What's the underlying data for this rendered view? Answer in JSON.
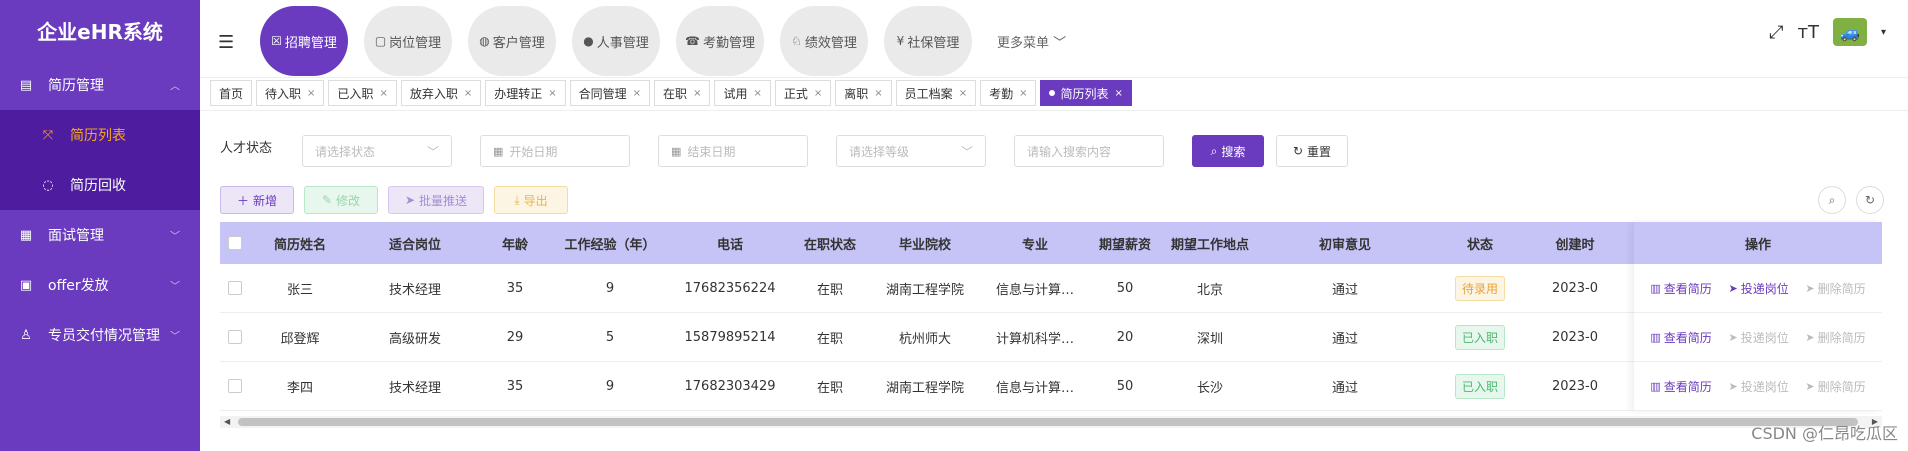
{
  "sidebar": {
    "title": "企业eHR系统",
    "menu": [
      {
        "label": "简历管理",
        "icon": "document-icon",
        "glyph": "▤"
      },
      {
        "label": "面试管理",
        "icon": "interview-icon",
        "glyph": "▦"
      },
      {
        "label": "offer发放",
        "icon": "offer-icon",
        "glyph": "▣"
      },
      {
        "label": "专员交付情况管理",
        "icon": "person-icon",
        "glyph": "♙"
      }
    ],
    "submenu": [
      {
        "label": "简历列表",
        "glyph": "⤧"
      },
      {
        "label": "简历回收",
        "glyph": "◌"
      }
    ]
  },
  "header": {
    "nav": [
      {
        "label": "招聘管理",
        "glyph": "☒"
      },
      {
        "label": "岗位管理",
        "glyph": "▢"
      },
      {
        "label": "客户管理",
        "glyph": "◍"
      },
      {
        "label": "人事管理",
        "glyph": "●"
      },
      {
        "label": "考勤管理",
        "glyph": "☎"
      },
      {
        "label": "绩效管理",
        "glyph": "♘"
      },
      {
        "label": "社保管理",
        "glyph": "¥"
      }
    ],
    "more": "更多菜单"
  },
  "tags": [
    {
      "label": "首页",
      "closable": false
    },
    {
      "label": "待入职",
      "closable": true
    },
    {
      "label": "已入职",
      "closable": true
    },
    {
      "label": "放弃入职",
      "closable": true
    },
    {
      "label": "办理转正",
      "closable": true
    },
    {
      "label": "合同管理",
      "closable": true
    },
    {
      "label": "在职",
      "closable": true
    },
    {
      "label": "试用",
      "closable": true
    },
    {
      "label": "正式",
      "closable": true
    },
    {
      "label": "离职",
      "closable": true
    },
    {
      "label": "员工档案",
      "closable": true
    },
    {
      "label": "考勤",
      "closable": true
    },
    {
      "label": "简历列表",
      "closable": true
    }
  ],
  "filter": {
    "label": "人才状态",
    "status_placeholder": "请选择状态",
    "start_placeholder": "开始日期",
    "end_placeholder": "结束日期",
    "level_placeholder": "请选择等级",
    "search_placeholder": "请输入搜索内容",
    "search_btn": "搜索",
    "reset_btn": "重置"
  },
  "toolbar": {
    "add": "新增",
    "edit": "修改",
    "push": "批量推送",
    "export": "导出"
  },
  "table": {
    "columns": [
      "简历姓名",
      "适合岗位",
      "年龄",
      "工作经验（年）",
      "电话",
      "在职状态",
      "毕业院校",
      "专业",
      "期望薪资",
      "期望工作地点",
      "初审意见",
      "状态",
      "创建时"
    ],
    "rows": [
      [
        "张三",
        "技术经理",
        "35",
        "9",
        "17682356224",
        "在职",
        "湖南工程学院",
        "信息与计算…",
        "50",
        "北京",
        "通过",
        "待录用",
        "2023-0"
      ],
      [
        "邱登辉",
        "高级研发",
        "29",
        "5",
        "15879895214",
        "在职",
        "杭州师大",
        "计算机科学…",
        "20",
        "深圳",
        "通过",
        "已入职",
        "2023-0"
      ],
      [
        "李四",
        "技术经理",
        "35",
        "9",
        "17682303429",
        "在职",
        "湖南工程学院",
        "信息与计算…",
        "50",
        "长沙",
        "通过",
        "已入职",
        "2023-0"
      ]
    ],
    "ops_header": "操作",
    "ops": {
      "view": "查看简历",
      "push": "投递岗位",
      "delete": "删除简历"
    }
  },
  "watermark": "CSDN @仁昂吃瓜区"
}
